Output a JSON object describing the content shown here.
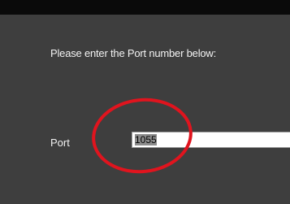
{
  "dialog": {
    "instruction": "Please enter the Port number below:",
    "port_label": "Port",
    "port_value": "1055"
  },
  "colors": {
    "background": "#3e3e3e",
    "title_bar": "#0a0a0a",
    "text": "#f2f2f2",
    "annotation": "#e0141e"
  }
}
